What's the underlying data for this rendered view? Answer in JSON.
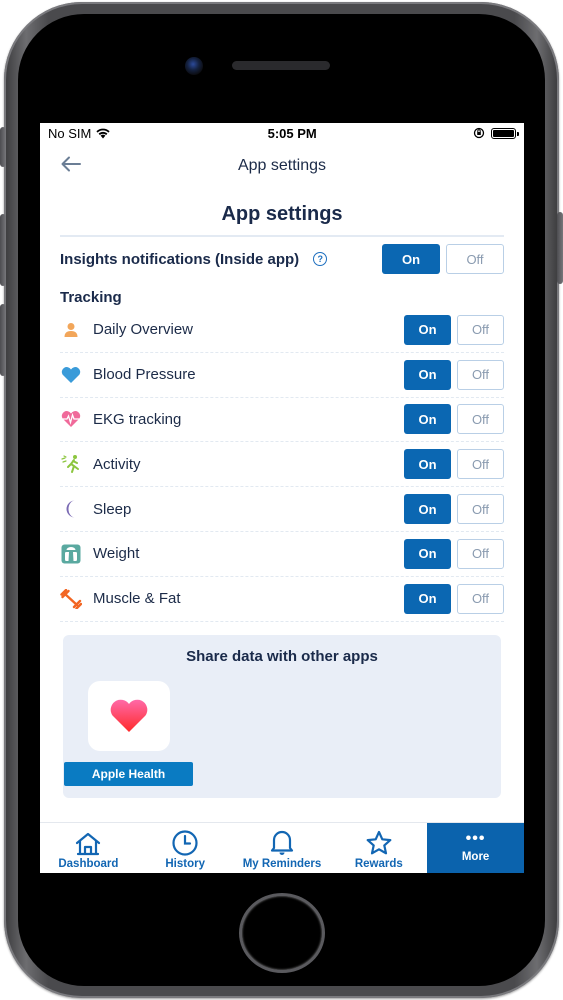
{
  "status_bar": {
    "carrier": "No SIM",
    "time": "5:05 PM",
    "wifi_icon": "wifi-icon",
    "orientation_lock_icon": "orientation-lock-icon",
    "battery_icon": "battery-icon"
  },
  "nav": {
    "title": "App settings",
    "back_icon": "arrow-left-icon"
  },
  "page": {
    "heading": "App settings"
  },
  "insights": {
    "label": "Insights notifications (Inside app)",
    "help_icon": "question-circle-icon",
    "help_glyph": "?",
    "on_label": "On",
    "off_label": "Off",
    "selected": "On"
  },
  "tracking": {
    "label": "Tracking",
    "items": [
      {
        "label": "Daily Overview",
        "icon": "person-icon",
        "color": "#f2a65a",
        "on_label": "On",
        "off_label": "Off",
        "selected": "On"
      },
      {
        "label": "Blood Pressure",
        "icon": "heart-icon",
        "color": "#3a9bd9",
        "on_label": "On",
        "off_label": "Off",
        "selected": "On"
      },
      {
        "label": "EKG tracking",
        "icon": "heart-pulse-icon",
        "color": "#f06a9a",
        "on_label": "On",
        "off_label": "Off",
        "selected": "On"
      },
      {
        "label": "Activity",
        "icon": "running-icon",
        "color": "#8cc63f",
        "on_label": "On",
        "off_label": "Off",
        "selected": "On"
      },
      {
        "label": "Sleep",
        "icon": "moon-icon",
        "color": "#7b6bb4",
        "on_label": "On",
        "off_label": "Off",
        "selected": "On"
      },
      {
        "label": "Weight",
        "icon": "scale-icon",
        "color": "#5aa9a0",
        "on_label": "On",
        "off_label": "Off",
        "selected": "On"
      },
      {
        "label": "Muscle & Fat",
        "icon": "dumbbell-icon",
        "color": "#f26522",
        "on_label": "On",
        "off_label": "Off",
        "selected": "On"
      }
    ]
  },
  "share": {
    "title": "Share data with other apps",
    "apps": [
      {
        "name": "Apple Health",
        "icon": "apple-health-heart-icon"
      }
    ]
  },
  "tab_bar": {
    "items": [
      {
        "label": "Dashboard",
        "icon": "home-icon",
        "active": false
      },
      {
        "label": "History",
        "icon": "clock-icon",
        "active": false
      },
      {
        "label": "My Reminders",
        "icon": "bell-icon",
        "active": false
      },
      {
        "label": "Rewards",
        "icon": "star-icon",
        "active": false
      },
      {
        "label": "More",
        "icon": "more-dots-icon",
        "active": true,
        "glyph": "•••"
      }
    ]
  },
  "colors": {
    "primary": "#0b67b2",
    "heading_text": "#1a2a4a",
    "share_card_bg": "#e9eef7",
    "apple_health_button": "#0a7bc2"
  }
}
